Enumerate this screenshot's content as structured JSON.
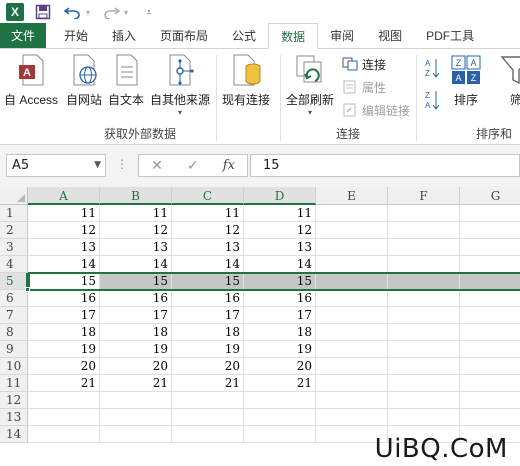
{
  "qat": {
    "logo": "X"
  },
  "tabs": [
    {
      "label": "文件",
      "kind": "file"
    },
    {
      "label": "开始"
    },
    {
      "label": "插入"
    },
    {
      "label": "页面布局"
    },
    {
      "label": "公式"
    },
    {
      "label": "数据",
      "active": true
    },
    {
      "label": "审阅"
    },
    {
      "label": "视图"
    },
    {
      "label": "PDF工具"
    }
  ],
  "ribbon": {
    "external_group": {
      "label": "获取外部数据",
      "buttons": [
        "自 Access",
        "自网站",
        "自文本",
        "自其他来源"
      ]
    },
    "existing_connections": "现有连接",
    "connections_group": {
      "label": "连接",
      "refresh_all": "全部刷新",
      "connections": "连接",
      "properties": "属性",
      "edit_links": "编辑链接"
    },
    "sort_group": {
      "label": "排序和",
      "sort": "排序",
      "filter": "筛"
    }
  },
  "formula_bar": {
    "name_box": "A5",
    "fx": "fx",
    "value": "15"
  },
  "grid": {
    "columns": [
      "A",
      "B",
      "C",
      "D",
      "E",
      "F",
      "G"
    ],
    "rows": [
      "1",
      "2",
      "3",
      "4",
      "5",
      "6",
      "7",
      "8",
      "9",
      "10",
      "11",
      "12",
      "13",
      "14"
    ],
    "selected_row": 5,
    "data": [
      [
        "11",
        "11",
        "11",
        "11"
      ],
      [
        "12",
        "12",
        "12",
        "12"
      ],
      [
        "13",
        "13",
        "13",
        "13"
      ],
      [
        "14",
        "14",
        "14",
        "14"
      ],
      [
        "15",
        "15",
        "15",
        "15"
      ],
      [
        "16",
        "16",
        "16",
        "16"
      ],
      [
        "17",
        "17",
        "17",
        "17"
      ],
      [
        "18",
        "18",
        "18",
        "18"
      ],
      [
        "19",
        "19",
        "19",
        "19"
      ],
      [
        "20",
        "20",
        "20",
        "20"
      ],
      [
        "21",
        "21",
        "21",
        "21"
      ]
    ]
  },
  "watermark": "UiBQ.CoM",
  "colors": {
    "accent": "#217346",
    "selection": "#c6c6c6"
  }
}
